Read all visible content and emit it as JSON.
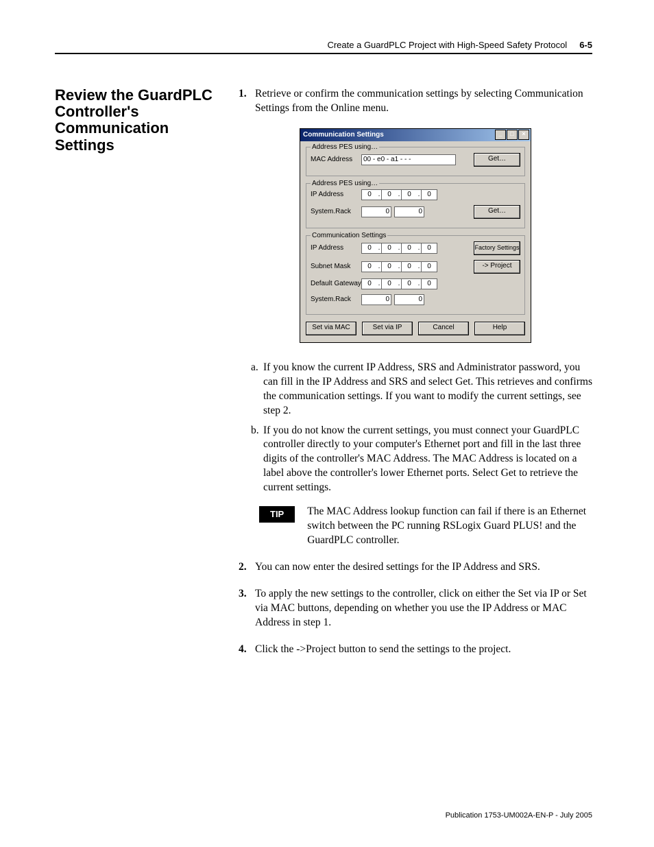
{
  "header": {
    "chapter": "Create a GuardPLC Project with High-Speed Safety Protocol",
    "page": "6-5"
  },
  "section_title": "Review the GuardPLC Controller's Communication Settings",
  "steps": {
    "s1": {
      "num": "1.",
      "text": "Retrieve or confirm the communication settings by selecting Communication Settings from the Online menu."
    },
    "s2": {
      "num": "2.",
      "text": "You can now enter the desired settings for the IP Address and SRS."
    },
    "s3": {
      "num": "3.",
      "text": "To apply the new settings to the controller, click on either the Set via IP or Set via MAC buttons, depending on whether you use the IP Address or MAC Address in step 1."
    },
    "s4": {
      "num": "4.",
      "text": "Click the ->Project button to send the settings to the project."
    }
  },
  "sub": {
    "a": {
      "m": "a.",
      "text": "If you know the current IP Address, SRS and Administrator password, you can fill in the IP Address and SRS and select Get. This retrieves and confirms the communication settings. If you want to modify the current settings, see step 2."
    },
    "b": {
      "m": "b.",
      "text": "If you do not know the current settings, you must connect your GuardPLC controller directly to your computer's Ethernet port and fill in the last three digits of the controller's MAC Address. The MAC Address is located on a label above the controller's lower Ethernet ports. Select Get to retrieve the current settings."
    }
  },
  "tip": {
    "label": "TIP",
    "text": "The MAC Address lookup function can fail if there is an Ethernet switch between the PC running RSLogix Guard PLUS! and the GuardPLC controller."
  },
  "dialog": {
    "title": "Communication Settings",
    "win": {
      "min": "_",
      "max": "□",
      "close": "×"
    },
    "group1": {
      "legend": "Address PES using…",
      "mac_label": "MAC Address",
      "mac_value": "00 - e0 - a1 -    -    -   ",
      "get": "Get…"
    },
    "group2": {
      "legend": "Address PES using…",
      "ip_label": "IP Address",
      "ip": [
        "0",
        "0",
        "0",
        "0"
      ],
      "sr_label": "System.Rack",
      "sr": [
        "0",
        "0"
      ],
      "get": "Get…"
    },
    "group3": {
      "legend": "Communication Settings",
      "ip_label": "IP Address",
      "ip": [
        "0",
        "0",
        "0",
        "0"
      ],
      "sm_label": "Subnet Mask",
      "sm": [
        "0",
        "0",
        "0",
        "0"
      ],
      "gw_label": "Default Gateway",
      "gw": [
        "0",
        "0",
        "0",
        "0"
      ],
      "sr_label": "System.Rack",
      "sr": [
        "0",
        "0"
      ],
      "factory": "Factory Settings",
      "project": "-> Project"
    },
    "buttons": {
      "setmac": "Set via MAC",
      "setip": "Set via IP",
      "cancel": "Cancel",
      "help": "Help"
    }
  },
  "footer": "Publication 1753-UM002A-EN-P - July 2005"
}
